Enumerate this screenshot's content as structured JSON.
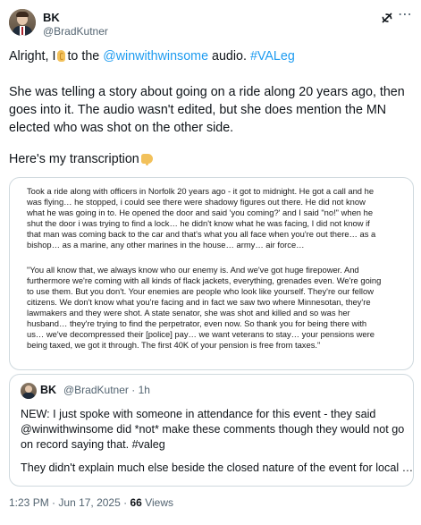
{
  "author": {
    "name": "BK",
    "handle": "@BradKutner"
  },
  "tweet": {
    "line1_pre": "Alright, I",
    "line1_mid": "to the",
    "line1_mention": "@winwithwinsome",
    "line1_post": "audio.",
    "line1_hashtag": "#VALeg",
    "para2_line1": "She was telling a story about going on a ride along 20 years ago, then",
    "para2_line2": "goes into it. The audio wasn't edited, but she does mention the MN",
    "para2_line3": "elected who was shot on the other side.",
    "para3": "Here's my transcription"
  },
  "transcription": {
    "lines": [
      "Took a ride along with officers in Norfolk 20 years ago - it got to midnight. He got a call and he",
      "was flying… he stopped, i could see there were shadowy figures out there. He did not know",
      "what he was going in to. He opened the door and said 'you coming?' and I said \"no!\" when he",
      "shut the door i was trying to find a lock… he didn't know what he was facing, I did not know if",
      "that man was coming back to the car and that's what you all face when you're out there… as a",
      "bishop… as a marine, any other marines in the house… army… air force…",
      "",
      "\"You all know that, we always know who our enemy is. And we've got huge firepower. And",
      "furthermore we're coming with all kinds of flack jackets, everything, grenades even. We're going",
      "to use them. But you don't. Your enemies are people who look like yourself. They're our fellow",
      "citizens. We don't know what you're facing and in fact we saw two where Minnesotan, they're",
      "lawmakers and they were shot. A state senator, she was shot and killed and so was her",
      "husband… they're trying to find the perpetrator, even now. So thank you for being there with",
      "us… we've decompressed their [police] pay… we want veterans to stay… your pensions were",
      "being taxed, we got it through. The first 40K of your pension is free from taxes.\""
    ]
  },
  "quoted": {
    "name": "BK",
    "handle": "@BradKutner",
    "time": "· 1h",
    "line1": "NEW: I just spoke with someone in attendance for this event - they said",
    "line2": "@winwithwinsome did *not* make these comments though they would not go",
    "line3": "on record saying that. #valeg",
    "line4": "They didn't explain much else beside the closed nature of the event for local …"
  },
  "meta": {
    "time": "1:23 PM",
    "dot1": "·",
    "date": "Jun 17, 2025",
    "dot2": "·",
    "views_count": "66",
    "views_label": "Views"
  },
  "icons": [
    "grok-icon",
    "more-icon",
    "ear-emoji",
    "backhand-index-pointing-down-emoji"
  ]
}
